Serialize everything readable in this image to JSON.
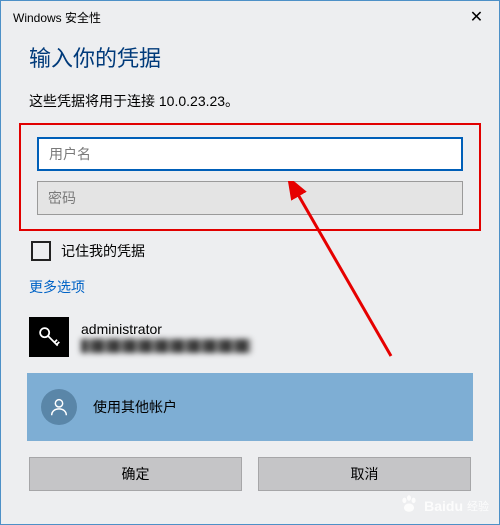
{
  "titlebar": {
    "text": "Windows 安全性"
  },
  "heading": "输入你的凭据",
  "subtext": "这些凭据将用于连接 10.0.23.23。",
  "inputs": {
    "username_placeholder": "用户名",
    "password_placeholder": "密码"
  },
  "remember_label": "记住我的凭据",
  "more_options": "更多选项",
  "accounts": {
    "saved": {
      "name": "administrator"
    },
    "other": {
      "label": "使用其他帐户"
    }
  },
  "buttons": {
    "ok": "确定",
    "cancel": "取消"
  },
  "watermark": {
    "brand": "Baidu",
    "cn": "经验"
  }
}
